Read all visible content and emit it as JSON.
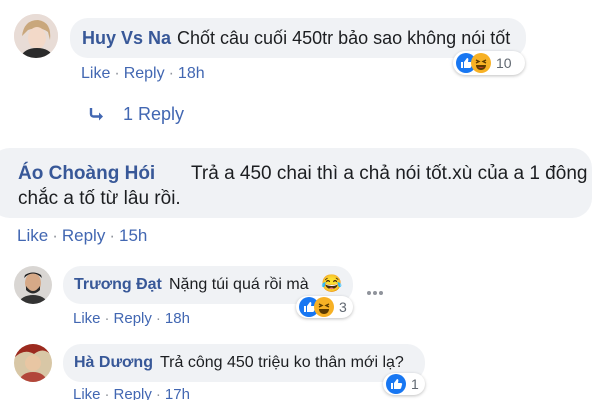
{
  "comments": [
    {
      "author": "Huy Vs Na",
      "text": "Chốt câu cuối 450tr bảo sao không nói tốt",
      "actions": {
        "like": "Like",
        "reply": "Reply",
        "time": "18h"
      },
      "reactions": {
        "icons": [
          "like-icon",
          "haha-icon"
        ],
        "count": "10"
      }
    },
    {
      "author": "Áo Choàng Hói",
      "text_line1": "Trả a 450 chai thì a chả nói tốt.xù của a 1 đông",
      "text_line2": "chắc a tố từ lâu rồi.",
      "actions": {
        "like": "Like",
        "reply": "Reply",
        "time": "15h"
      }
    },
    {
      "author": "Trương Đạt",
      "text": "Nặng túi quá rồi mà",
      "emoji": "😂",
      "actions": {
        "like": "Like",
        "reply": "Reply",
        "time": "18h"
      },
      "reactions": {
        "icons": [
          "like-icon",
          "haha-icon"
        ],
        "count": "3"
      }
    },
    {
      "author": "Hà Dương",
      "text": "Trả công 450 triệu ko thân mới lạ?",
      "actions": {
        "like": "Like",
        "reply": "Reply",
        "time": "17h"
      },
      "reactions": {
        "icons": [
          "like-icon"
        ],
        "count": "1"
      }
    }
  ],
  "replies_toggle": {
    "label": "1 Reply",
    "icon": "reply-arrow-icon"
  },
  "colors": {
    "link": "#4267b2",
    "name": "#385898",
    "bubble": "#f0f2f5",
    "like": "#1877f2",
    "haha": "#f7b125"
  }
}
